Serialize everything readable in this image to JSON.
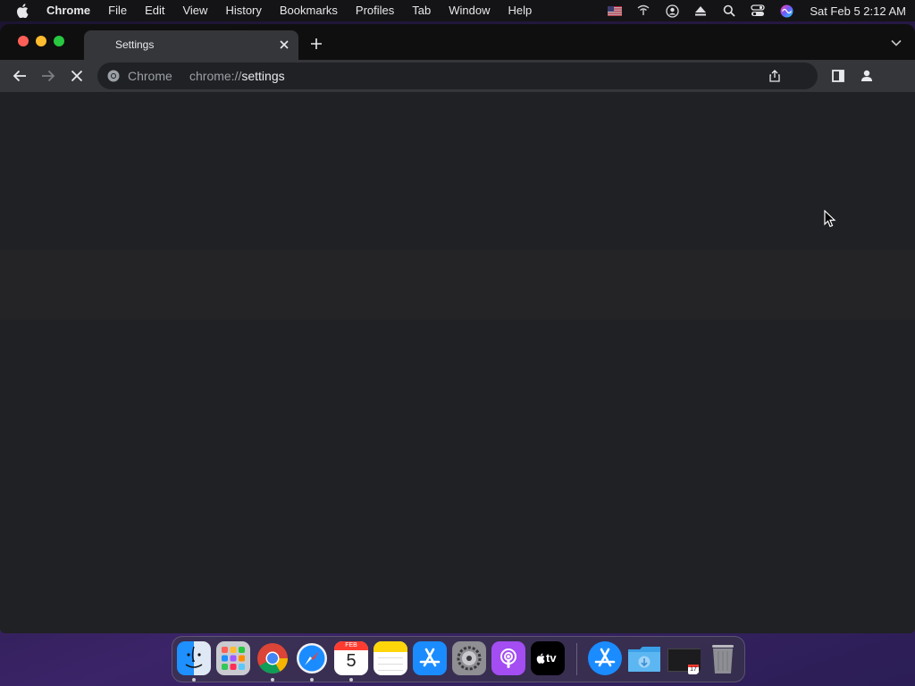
{
  "menubar": {
    "app_name": "Chrome",
    "items": [
      "File",
      "Edit",
      "View",
      "History",
      "Bookmarks",
      "Profiles",
      "Tab",
      "Window",
      "Help"
    ],
    "status_icons": [
      "flag-us-icon",
      "wifi-icon",
      "user-account-icon",
      "eject-icon",
      "spotlight-search-icon",
      "control-center-icon",
      "siri-icon"
    ],
    "clock": "Sat Feb 5  2:12 AM"
  },
  "tab": {
    "title": "Settings",
    "close_icon": "close-icon"
  },
  "toolbar": {
    "back_icon": "back-arrow-icon",
    "forward_icon": "forward-arrow-icon",
    "stop_icon": "stop-loading-icon",
    "omnibox": {
      "chip": "Chrome",
      "url_scheme": "chrome://",
      "url_host": "settings"
    },
    "share_icon": "share-icon",
    "side_panel_icon": "side-panel-icon",
    "profile_icon": "profile-icon"
  },
  "dock": {
    "apps": [
      "Finder",
      "Launchpad",
      "Google Chrome",
      "Safari",
      "Calendar",
      "Notes",
      "App Store",
      "System Preferences",
      "Podcasts",
      "TV",
      "App Store",
      "Downloads",
      "Calendar Screenshot",
      "Trash"
    ],
    "calendar_month": "FEB",
    "calendar_day": "5",
    "tv_label": "tv",
    "mini_day": "17"
  },
  "colors": {
    "window_bg": "#202124",
    "toolbar_bg": "#35363a",
    "tabstrip_bg": "#0f0f10",
    "menubar_bg": "#141416",
    "text_primary": "#e8eaed",
    "text_secondary": "#9aa0a6"
  }
}
